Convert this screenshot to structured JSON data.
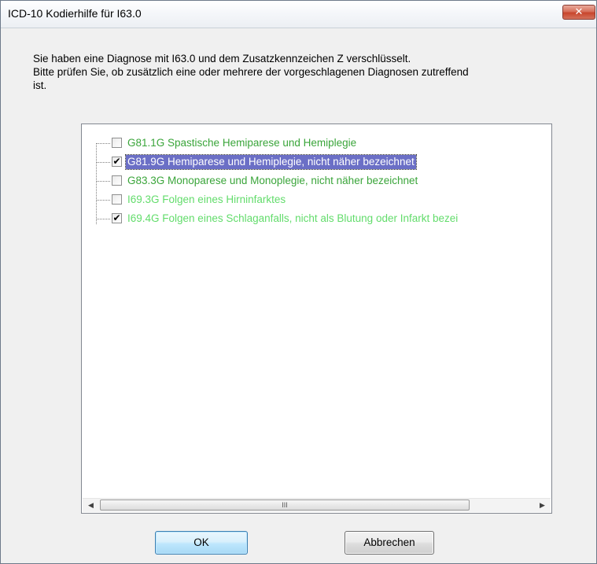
{
  "window": {
    "title": "ICD-10 Kodierhilfe für I63.0",
    "close_glyph": "✕"
  },
  "message": {
    "line1": "Sie haben eine Diagnose mit I63.0 und dem Zusatzkennzeichen Z verschlüsselt.",
    "line2": "Bitte prüfen Sie, ob zusätzlich eine oder mehrere der vorgeschlagenen Diagnosen zutreffend",
    "line3": "ist."
  },
  "diagnoses": [
    {
      "label": "G81.1G Spastische Hemiparese und Hemiplegie",
      "checked": false,
      "check_glyph": "",
      "color": "#3aa53a"
    },
    {
      "label": "G81.9G Hemiparese und Hemiplegie, nicht näher bezeichnet",
      "checked": true,
      "check_glyph": "✔",
      "selected": true,
      "color": "#ffffff"
    },
    {
      "label": "G83.3G Monoparese und Monoplegie, nicht näher bezeichnet",
      "checked": false,
      "check_glyph": "",
      "color": "#3aa53a"
    },
    {
      "label": "I69.3G Folgen eines Hirninfarktes",
      "checked": false,
      "check_glyph": "",
      "color": "#62dc6b"
    },
    {
      "label": "I69.4G Folgen eines Schlaganfalls, nicht als Blutung oder Infarkt bezei",
      "checked": true,
      "check_glyph": "✔",
      "color": "#62dc6b"
    }
  ],
  "scrollbar": {
    "left_arrow": "◀",
    "right_arrow": "▶",
    "grip": "III"
  },
  "buttons": {
    "ok_label": "OK",
    "cancel_label": "Abbrechen"
  }
}
